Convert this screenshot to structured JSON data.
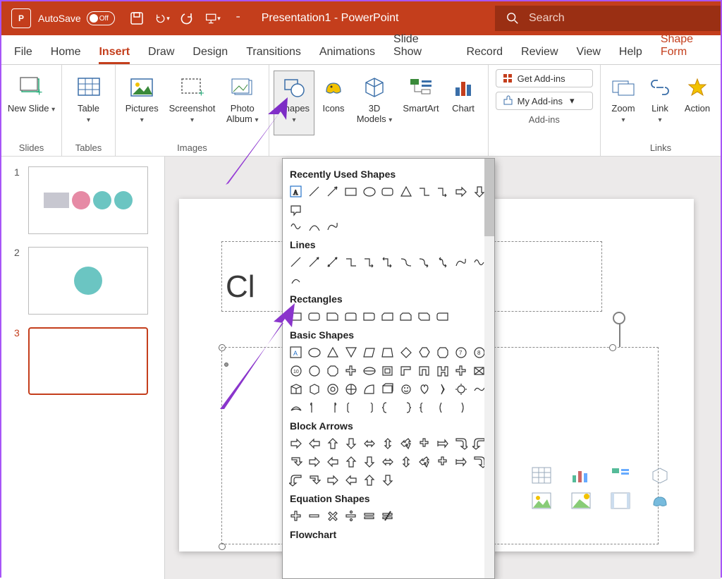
{
  "titlebar": {
    "autosave_label": "AutoSave",
    "switch_text": "Off",
    "doc_title": "Presentation1  -  PowerPoint",
    "search_placeholder": "Search"
  },
  "tabs": [
    "File",
    "Home",
    "Insert",
    "Draw",
    "Design",
    "Transitions",
    "Animations",
    "Slide Show",
    "Record",
    "Review",
    "View",
    "Help",
    "Shape Form"
  ],
  "active_tab": "Insert",
  "ribbon": {
    "groups": {
      "slides": {
        "label": "Slides",
        "buttons": [
          {
            "label": "New Slide"
          }
        ]
      },
      "tables": {
        "label": "Tables",
        "buttons": [
          {
            "label": "Table"
          }
        ]
      },
      "images": {
        "label": "Images",
        "buttons": [
          {
            "label": "Pictures"
          },
          {
            "label": "Screenshot"
          },
          {
            "label": "Photo Album"
          }
        ]
      },
      "illustrations": {
        "label": "",
        "buttons": [
          {
            "label": "Shapes"
          },
          {
            "label": "Icons"
          },
          {
            "label": "3D Models"
          },
          {
            "label": "SmartArt"
          },
          {
            "label": "Chart"
          }
        ]
      },
      "addins": {
        "label": "Add-ins",
        "get": "Get Add-ins",
        "my": "My Add-ins"
      },
      "links": {
        "label": "Links",
        "buttons": [
          {
            "label": "Zoom"
          },
          {
            "label": "Link"
          },
          {
            "label": "Action"
          }
        ]
      }
    }
  },
  "thumbnails": [
    {
      "num": "1"
    },
    {
      "num": "2"
    },
    {
      "num": "3"
    }
  ],
  "selected_thumb": 3,
  "slide": {
    "title_partial": "Cl"
  },
  "shapes_panel": {
    "categories": [
      "Recently Used Shapes",
      "Lines",
      "Rectangles",
      "Basic Shapes",
      "Block Arrows",
      "Equation Shapes",
      "Flowchart"
    ]
  }
}
